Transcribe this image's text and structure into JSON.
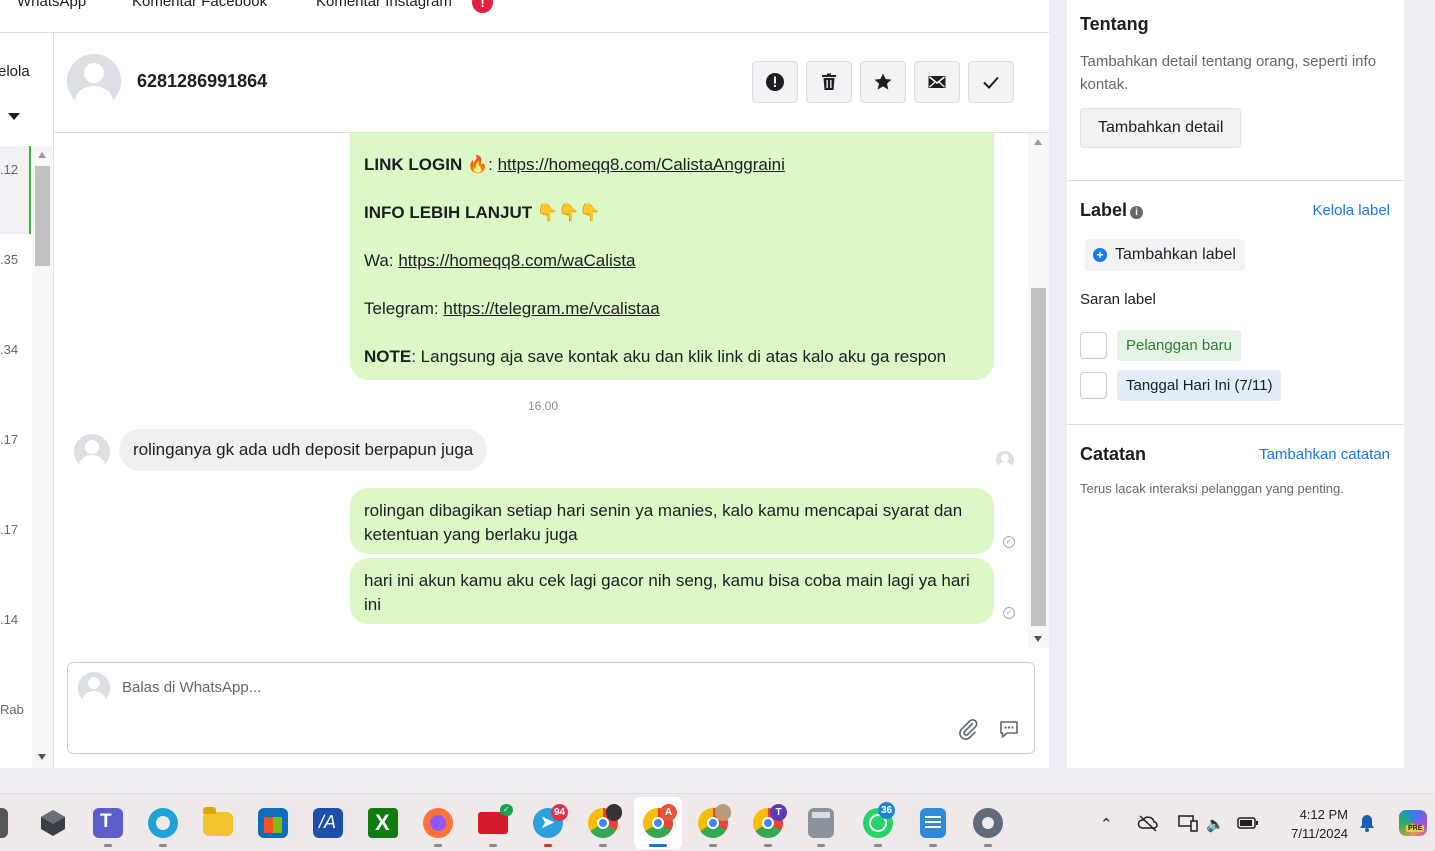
{
  "tabs": [
    {
      "label": "WhatsApp"
    },
    {
      "label": "Komentar Facebook"
    },
    {
      "label": "Komentar Instagram"
    }
  ],
  "tab_badge": "!",
  "left_list": {
    "kelola_label": "elola",
    "times": [
      ".12",
      ".35",
      ".34",
      ".17",
      ".17",
      ".14",
      "Rab"
    ]
  },
  "chat": {
    "contact_name": "6281286991864",
    "header_buttons": [
      "mark-spam",
      "delete",
      "star",
      "mark-unread",
      "mark-done"
    ]
  },
  "messages": {
    "m1": {
      "l1_label": "LINK LOGIN",
      "l1_emoji": "🔥",
      "l1_sep": ":",
      "l1_link": "https://homeqq8.com/CalistaAnggraini",
      "l2_label": "INFO LEBIH LANJUT",
      "l2_emoji": "👇👇👇",
      "l3_label": "Wa:",
      "l3_link": "https://homeqq8.com/waCalista",
      "l4_label": "Telegram:",
      "l4_link": "https://telegram.me/vcalistaa",
      "l5_label": "NOTE",
      "l5_text": ": Langsung aja save kontak aku dan klik link di atas kalo aku ga respon"
    },
    "time_divider": "16.00",
    "m2": "rolinganya gk ada udh deposit berpapun juga",
    "m3": "rolingan dibagikan setiap hari senin ya manies, kalo kamu mencapai syarat dan ketentuan yang berlaku juga",
    "m4": "hari ini akun kamu aku cek lagi gacor nih seng, kamu bisa coba main lagi ya hari ini"
  },
  "composer": {
    "placeholder": "Balas di WhatsApp..."
  },
  "right": {
    "about_title": "Tentang",
    "about_desc": "Tambahkan detail tentang orang, seperti info kontak.",
    "add_detail": "Tambahkan detail",
    "label_title": "Label",
    "info_icon": "i",
    "manage_label": "Kelola label",
    "add_label": "Tambahkan label",
    "suggest_title": "Saran label",
    "suggestions": [
      "Pelanggan baru",
      "Tanggal Hari Ini (7/11)"
    ],
    "notes_title": "Catatan",
    "add_note": "Tambahkan catatan",
    "notes_desc": "Terus lacak interaksi pelanggan yang penting."
  },
  "taskbar": {
    "badges": {
      "telegram": "94",
      "chrome_a": "A",
      "chrome_t": "T",
      "whatsapp": "36"
    },
    "time": "4:12 PM",
    "date": "7/11/2024",
    "pre_badge": "PRE"
  },
  "colors": {
    "outgoing_bubble": "#dcf8c6",
    "incoming_bubble": "#eff0f2",
    "link_blue": "#1877f2",
    "badge_red": "#e41e3f"
  }
}
